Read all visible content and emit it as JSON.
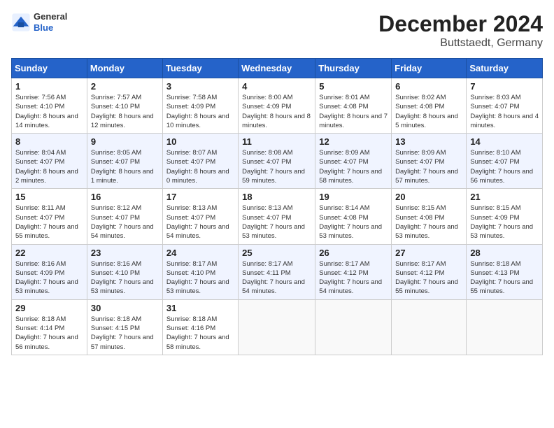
{
  "header": {
    "logo_general": "General",
    "logo_blue": "Blue",
    "title": "December 2024",
    "subtitle": "Buttstaedt, Germany"
  },
  "weekdays": [
    "Sunday",
    "Monday",
    "Tuesday",
    "Wednesday",
    "Thursday",
    "Friday",
    "Saturday"
  ],
  "weeks": [
    [
      {
        "day": "1",
        "sunrise": "Sunrise: 7:56 AM",
        "sunset": "Sunset: 4:10 PM",
        "daylight": "Daylight: 8 hours and 14 minutes."
      },
      {
        "day": "2",
        "sunrise": "Sunrise: 7:57 AM",
        "sunset": "Sunset: 4:10 PM",
        "daylight": "Daylight: 8 hours and 12 minutes."
      },
      {
        "day": "3",
        "sunrise": "Sunrise: 7:58 AM",
        "sunset": "Sunset: 4:09 PM",
        "daylight": "Daylight: 8 hours and 10 minutes."
      },
      {
        "day": "4",
        "sunrise": "Sunrise: 8:00 AM",
        "sunset": "Sunset: 4:09 PM",
        "daylight": "Daylight: 8 hours and 8 minutes."
      },
      {
        "day": "5",
        "sunrise": "Sunrise: 8:01 AM",
        "sunset": "Sunset: 4:08 PM",
        "daylight": "Daylight: 8 hours and 7 minutes."
      },
      {
        "day": "6",
        "sunrise": "Sunrise: 8:02 AM",
        "sunset": "Sunset: 4:08 PM",
        "daylight": "Daylight: 8 hours and 5 minutes."
      },
      {
        "day": "7",
        "sunrise": "Sunrise: 8:03 AM",
        "sunset": "Sunset: 4:07 PM",
        "daylight": "Daylight: 8 hours and 4 minutes."
      }
    ],
    [
      {
        "day": "8",
        "sunrise": "Sunrise: 8:04 AM",
        "sunset": "Sunset: 4:07 PM",
        "daylight": "Daylight: 8 hours and 2 minutes."
      },
      {
        "day": "9",
        "sunrise": "Sunrise: 8:05 AM",
        "sunset": "Sunset: 4:07 PM",
        "daylight": "Daylight: 8 hours and 1 minute."
      },
      {
        "day": "10",
        "sunrise": "Sunrise: 8:07 AM",
        "sunset": "Sunset: 4:07 PM",
        "daylight": "Daylight: 8 hours and 0 minutes."
      },
      {
        "day": "11",
        "sunrise": "Sunrise: 8:08 AM",
        "sunset": "Sunset: 4:07 PM",
        "daylight": "Daylight: 7 hours and 59 minutes."
      },
      {
        "day": "12",
        "sunrise": "Sunrise: 8:09 AM",
        "sunset": "Sunset: 4:07 PM",
        "daylight": "Daylight: 7 hours and 58 minutes."
      },
      {
        "day": "13",
        "sunrise": "Sunrise: 8:09 AM",
        "sunset": "Sunset: 4:07 PM",
        "daylight": "Daylight: 7 hours and 57 minutes."
      },
      {
        "day": "14",
        "sunrise": "Sunrise: 8:10 AM",
        "sunset": "Sunset: 4:07 PM",
        "daylight": "Daylight: 7 hours and 56 minutes."
      }
    ],
    [
      {
        "day": "15",
        "sunrise": "Sunrise: 8:11 AM",
        "sunset": "Sunset: 4:07 PM",
        "daylight": "Daylight: 7 hours and 55 minutes."
      },
      {
        "day": "16",
        "sunrise": "Sunrise: 8:12 AM",
        "sunset": "Sunset: 4:07 PM",
        "daylight": "Daylight: 7 hours and 54 minutes."
      },
      {
        "day": "17",
        "sunrise": "Sunrise: 8:13 AM",
        "sunset": "Sunset: 4:07 PM",
        "daylight": "Daylight: 7 hours and 54 minutes."
      },
      {
        "day": "18",
        "sunrise": "Sunrise: 8:13 AM",
        "sunset": "Sunset: 4:07 PM",
        "daylight": "Daylight: 7 hours and 53 minutes."
      },
      {
        "day": "19",
        "sunrise": "Sunrise: 8:14 AM",
        "sunset": "Sunset: 4:08 PM",
        "daylight": "Daylight: 7 hours and 53 minutes."
      },
      {
        "day": "20",
        "sunrise": "Sunrise: 8:15 AM",
        "sunset": "Sunset: 4:08 PM",
        "daylight": "Daylight: 7 hours and 53 minutes."
      },
      {
        "day": "21",
        "sunrise": "Sunrise: 8:15 AM",
        "sunset": "Sunset: 4:09 PM",
        "daylight": "Daylight: 7 hours and 53 minutes."
      }
    ],
    [
      {
        "day": "22",
        "sunrise": "Sunrise: 8:16 AM",
        "sunset": "Sunset: 4:09 PM",
        "daylight": "Daylight: 7 hours and 53 minutes."
      },
      {
        "day": "23",
        "sunrise": "Sunrise: 8:16 AM",
        "sunset": "Sunset: 4:10 PM",
        "daylight": "Daylight: 7 hours and 53 minutes."
      },
      {
        "day": "24",
        "sunrise": "Sunrise: 8:17 AM",
        "sunset": "Sunset: 4:10 PM",
        "daylight": "Daylight: 7 hours and 53 minutes."
      },
      {
        "day": "25",
        "sunrise": "Sunrise: 8:17 AM",
        "sunset": "Sunset: 4:11 PM",
        "daylight": "Daylight: 7 hours and 54 minutes."
      },
      {
        "day": "26",
        "sunrise": "Sunrise: 8:17 AM",
        "sunset": "Sunset: 4:12 PM",
        "daylight": "Daylight: 7 hours and 54 minutes."
      },
      {
        "day": "27",
        "sunrise": "Sunrise: 8:17 AM",
        "sunset": "Sunset: 4:12 PM",
        "daylight": "Daylight: 7 hours and 55 minutes."
      },
      {
        "day": "28",
        "sunrise": "Sunrise: 8:18 AM",
        "sunset": "Sunset: 4:13 PM",
        "daylight": "Daylight: 7 hours and 55 minutes."
      }
    ],
    [
      {
        "day": "29",
        "sunrise": "Sunrise: 8:18 AM",
        "sunset": "Sunset: 4:14 PM",
        "daylight": "Daylight: 7 hours and 56 minutes."
      },
      {
        "day": "30",
        "sunrise": "Sunrise: 8:18 AM",
        "sunset": "Sunset: 4:15 PM",
        "daylight": "Daylight: 7 hours and 57 minutes."
      },
      {
        "day": "31",
        "sunrise": "Sunrise: 8:18 AM",
        "sunset": "Sunset: 4:16 PM",
        "daylight": "Daylight: 7 hours and 58 minutes."
      },
      null,
      null,
      null,
      null
    ]
  ]
}
